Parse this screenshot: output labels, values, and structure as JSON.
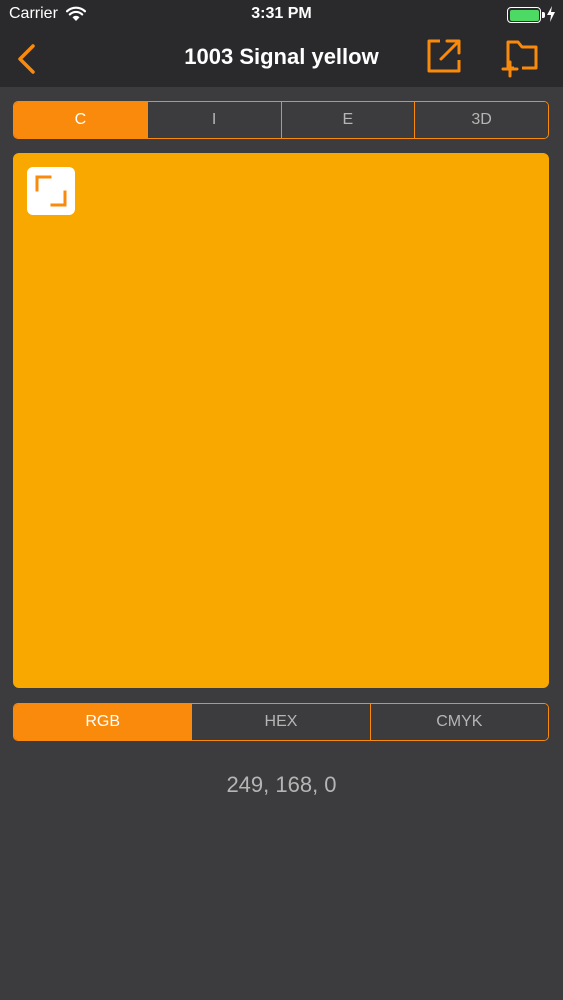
{
  "status_bar": {
    "carrier": "Carrier",
    "time": "3:31 PM"
  },
  "header": {
    "title": "1003 Signal yellow",
    "back_icon": "chevron-left-icon",
    "export_icon": "share-export-icon",
    "add_folder_icon": "folder-add-icon"
  },
  "view_tabs": [
    {
      "label": "C",
      "active": true
    },
    {
      "label": "I",
      "active": false
    },
    {
      "label": "E",
      "active": false
    },
    {
      "label": "3D",
      "active": false
    }
  ],
  "swatch": {
    "color": "#f9a800",
    "fullscreen_icon": "expand-corners-icon"
  },
  "format_tabs": [
    {
      "label": "RGB",
      "active": true
    },
    {
      "label": "HEX",
      "active": false
    },
    {
      "label": "CMYK",
      "active": false
    }
  ],
  "value": "249, 168, 0",
  "colors": {
    "accent": "#f98a0c",
    "background": "#3c3c3e",
    "bar": "#2a2a2c",
    "battery": "#4cd964"
  }
}
